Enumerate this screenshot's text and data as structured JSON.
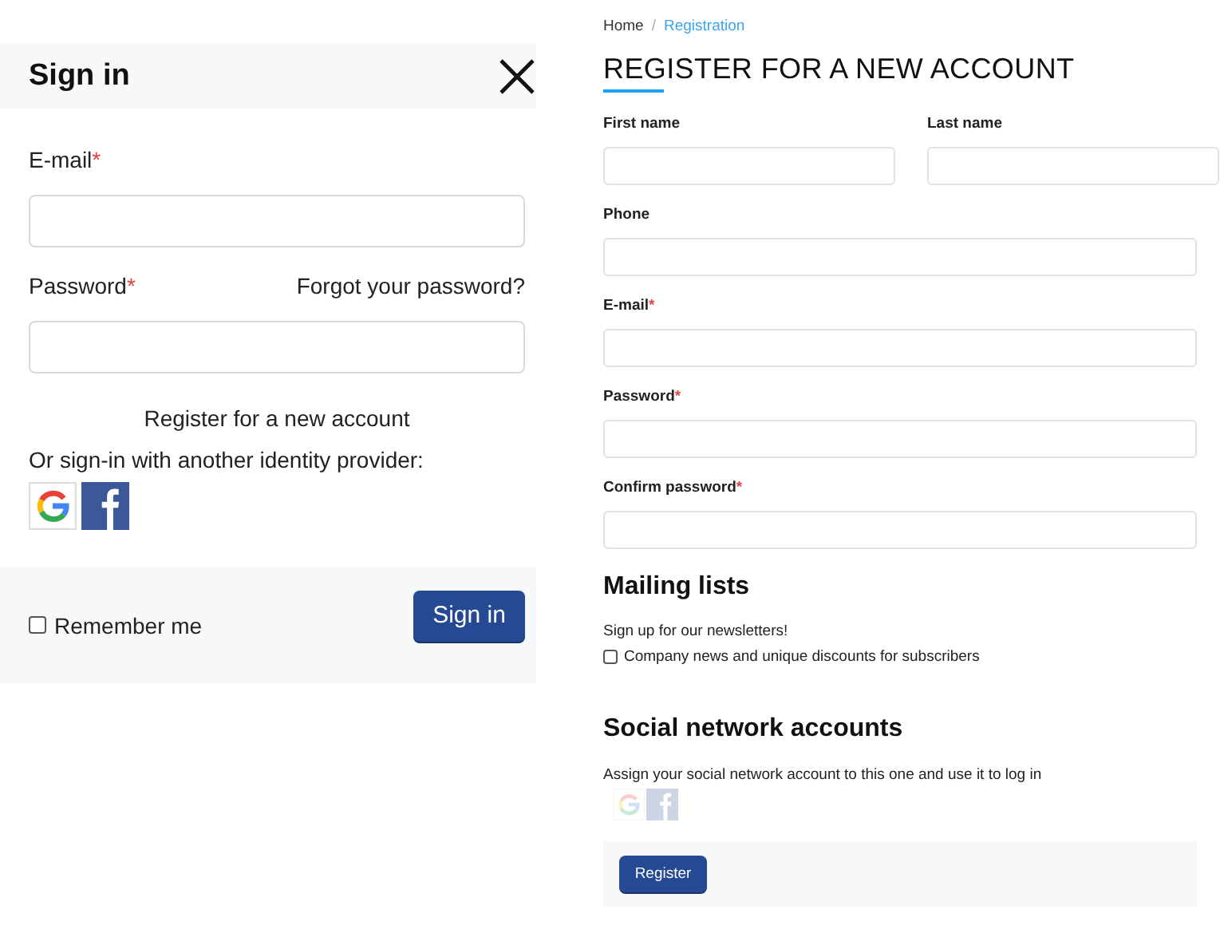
{
  "sign_in_dialog": {
    "title": "Sign in",
    "required_mark": "*",
    "fields": [
      {
        "label": "E-mail",
        "required": true
      },
      {
        "label": "Password",
        "required": true,
        "link": "Forgot your password?"
      }
    ],
    "register_link": "Register for a new account",
    "provider_prompt": "Or sign-in with another identity provider:",
    "providers": [
      {
        "kind": "google",
        "disabled": false
      },
      {
        "kind": "facebook",
        "disabled": false
      }
    ],
    "remember_me": {
      "label": "Remember me",
      "checked": false
    },
    "submit": "Sign in"
  },
  "registration": {
    "breadcrumb": [
      {
        "label": "Home",
        "selected": false
      },
      {
        "label": "Registration",
        "selected": true
      }
    ],
    "breadcrumb_separator": "/",
    "title": "REGISTER FOR A NEW ACCOUNT",
    "required_mark": "*",
    "name_fields": [
      {
        "label": "First name",
        "required": false
      },
      {
        "label": "Last name",
        "required": false
      }
    ],
    "fields": [
      {
        "label": "Phone",
        "required": false
      },
      {
        "label": "E-mail",
        "required": true
      },
      {
        "label": "Password",
        "required": true
      },
      {
        "label": "Confirm password",
        "required": true
      }
    ],
    "mailing_lists": {
      "heading": "Mailing lists",
      "intro": "Sign up for our newsletters!",
      "options": [
        {
          "label": "Company news and unique discounts for subscribers",
          "checked": false
        }
      ]
    },
    "social": {
      "heading": "Social network accounts",
      "text": "Assign your social network account to this one and use it to log in",
      "providers": [
        {
          "kind": "google",
          "disabled": true
        },
        {
          "kind": "facebook",
          "disabled": true
        }
      ]
    },
    "submit": "Register"
  }
}
